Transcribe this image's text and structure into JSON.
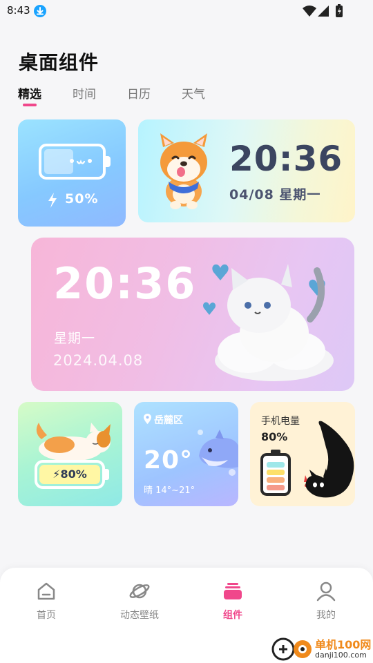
{
  "status_bar": {
    "time": "8:43"
  },
  "header": {
    "title": "桌面组件"
  },
  "tabs": [
    {
      "label": "精选",
      "active": true
    },
    {
      "label": "时间",
      "active": false
    },
    {
      "label": "日历",
      "active": false
    },
    {
      "label": "天气",
      "active": false
    }
  ],
  "widgets": {
    "battery": {
      "percent": "50%"
    },
    "clock": {
      "time": "20:36",
      "date": "04/08 星期一"
    },
    "big_clock": {
      "time": "20:36",
      "weekday": "星期一",
      "date": "2024.04.08"
    },
    "charging": {
      "percent": "80%"
    },
    "weather": {
      "location": "岳麓区",
      "temp": "20°",
      "range": "晴 14°~21°"
    },
    "power": {
      "label": "手机电量",
      "percent": "80%"
    }
  },
  "nav": [
    {
      "label": "首页",
      "icon": "home-icon",
      "active": false
    },
    {
      "label": "动态壁纸",
      "icon": "planet-icon",
      "active": false
    },
    {
      "label": "组件",
      "icon": "widgets-icon",
      "active": true
    },
    {
      "label": "我的",
      "icon": "profile-icon",
      "active": false
    }
  ],
  "watermark": {
    "text": "单机100网",
    "sub": "danji100.com"
  },
  "colors": {
    "accent": "#f0478b",
    "text": "#111111",
    "muted": "#888888"
  }
}
